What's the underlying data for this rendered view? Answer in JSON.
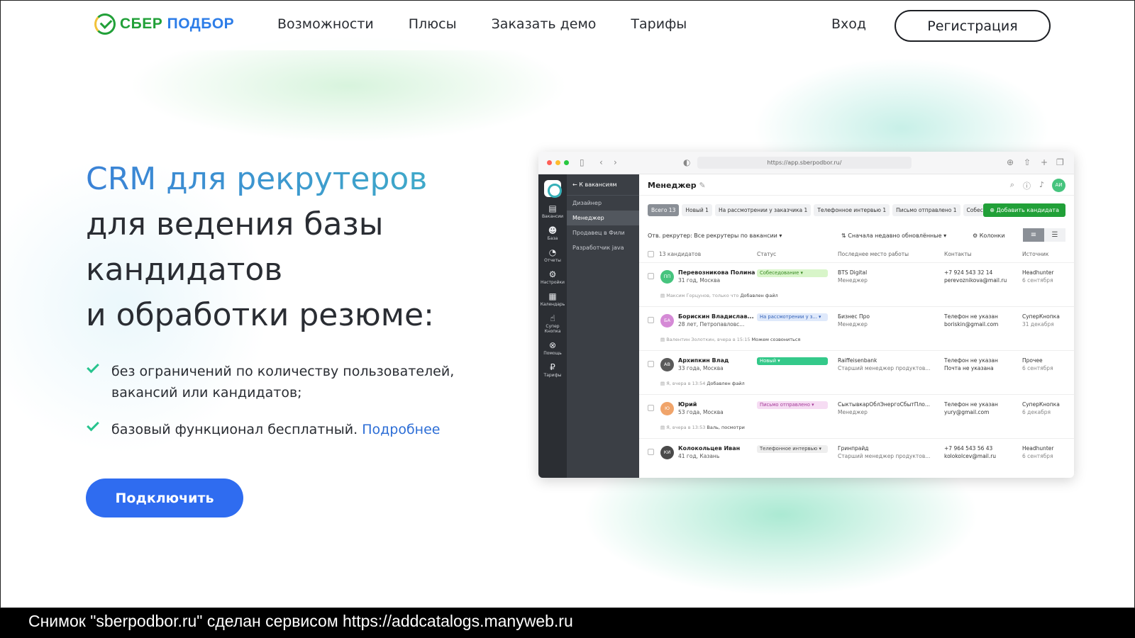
{
  "header": {
    "logo": {
      "part1": "СБЕР",
      "part2": "ПОДБОР"
    },
    "nav": [
      "Возможности",
      "Плюсы",
      "Заказать демо",
      "Тарифы"
    ],
    "login": "Вход",
    "register": "Регистрация"
  },
  "hero": {
    "title_accent": "CRM для рекрутеров",
    "title_lines": [
      "для ведения базы",
      "кандидатов",
      "и обработки резюме:"
    ],
    "bullets": [
      "без ограничений по количеству пользователей, вакансий или кандидатов;",
      "базовый функционал бесплатный."
    ],
    "more_link": "Подробнее",
    "cta": "Подключить"
  },
  "app": {
    "url": "https://app.sberpodbor.ru/",
    "sidebar": [
      {
        "label": "Вакансии",
        "icon": "document-icon",
        "glyph": "▤"
      },
      {
        "label": "База",
        "icon": "people-icon",
        "glyph": "☻"
      },
      {
        "label": "Отчеты",
        "icon": "pie-icon",
        "glyph": "◔"
      },
      {
        "label": "Настройки",
        "icon": "gear-icon",
        "glyph": "⚙"
      },
      {
        "label": "Календарь",
        "icon": "calendar-icon",
        "glyph": "▦"
      },
      {
        "label": "Супер Кнопка",
        "icon": "hand-icon",
        "glyph": "☝"
      },
      {
        "label": "Помощь",
        "icon": "help-icon",
        "glyph": "⊗"
      },
      {
        "label": "Тарифы",
        "icon": "tariff-icon",
        "glyph": "₽"
      }
    ],
    "back": "К вакансиям",
    "vacancies": [
      "Дизайнер",
      "Менеджер",
      "Продавец в Фили",
      "Разработчик java"
    ],
    "title": "Менеджер",
    "user_initials": "АИ",
    "tabs": [
      {
        "label": "Всего 13",
        "active": true
      },
      {
        "label": "Новый 1",
        "active": false
      },
      {
        "label": "На рассмотрении у заказчика 1",
        "active": false
      },
      {
        "label": "Телефонное интервью 1",
        "active": false
      },
      {
        "label": "Письмо отправлено 1",
        "active": false
      },
      {
        "label": "Собеседо",
        "active": false
      }
    ],
    "add_candidate": "Добавить кандидата",
    "filter": "Отв. рекрутер: Все рекрутеры по вакансии",
    "sort": "Сначала недавно обновлённые",
    "columns_btn": "Колонки",
    "headers": [
      "13 кандидатов",
      "Статус",
      "Последнее место работы",
      "Контакты",
      "Источник"
    ],
    "rows": [
      {
        "initials": "ПП",
        "avatar_color": "#46c47e",
        "name": "Перевозникова Полина",
        "sub": "31 год, Москва",
        "status": "Собеседование",
        "status_bg": "#d8f5c9",
        "status_fg": "#3a8a24",
        "job": "BTS Digital",
        "job2": "Менеджер",
        "c1": "+7 924 543 32 14",
        "c2": "perevoznikova@mail.ru",
        "s1": "Headhunter",
        "s2": "6 сентября",
        "note_meta": "Максим Горцунов, только что",
        "note_text": "Добавлен файл"
      },
      {
        "initials": "БА",
        "avatar_color": "#d58ad6",
        "name": "Борискин Владислав...",
        "sub": "28 лет, Петропавловс...",
        "status": "На рассмотрении у з...",
        "status_bg": "#dfe9fb",
        "status_fg": "#2f5fb7",
        "job": "Бизнес Про",
        "job2": "Менеджер",
        "c1": "Телефон не указан",
        "c2": "boriskin@gmail.com",
        "s1": "СуперКнопка",
        "s2": "31 декабря",
        "note_meta": "Валентин Золоткин, вчера в 15:15",
        "note_text": "Можем созвониться"
      },
      {
        "initials": "АВ",
        "avatar_color": "#5a5a5a",
        "name": "Архипкин Влад",
        "sub": "33 года, Москва",
        "status": "Новый",
        "status_bg": "#34c98a",
        "status_fg": "#ffffff",
        "job": "Raiffeisenbank",
        "job2": "Старший менеджер продуктов...",
        "c1": "Телефон не указан",
        "c2": "Почта не указана",
        "s1": "Прочее",
        "s2": "6 сентября",
        "note_meta": "Я, вчера в 13:54",
        "note_text": "Добавлен файл"
      },
      {
        "initials": "Ю",
        "avatar_color": "#f0a46a",
        "name": "Юрий",
        "sub": "53 года, Москва",
        "status": "Письмо отправлено",
        "status_bg": "#f6dcf3",
        "status_fg": "#a43a98",
        "job": "СыктывкарОблЭнергоСбытПло...",
        "job2": "Менеджер",
        "c1": "Телефон не указан",
        "c2": "yury@gmail.com",
        "s1": "СуперКнопка",
        "s2": "6 декабря",
        "note_meta": "Я, вчера в 13:53",
        "note_text": "Валь, посмотри"
      },
      {
        "initials": "КИ",
        "avatar_color": "#4a4a4a",
        "name": "Колокольцев Иван",
        "sub": "41 год, Казань",
        "status": "Телефонное интервью",
        "status_bg": "#eeeeee",
        "status_fg": "#444444",
        "job": "Гринпрайд",
        "job2": "Старший менеджер продуктов...",
        "c1": "+7 964 543 56 43",
        "c2": "kolokolcev@mail.ru",
        "s1": "Headhunter",
        "s2": "6 сентября",
        "note_meta": "",
        "note_text": ""
      }
    ]
  },
  "footer": "Снимок \"sberpodbor.ru\" сделан сервисом https://addcatalogs.manyweb.ru"
}
